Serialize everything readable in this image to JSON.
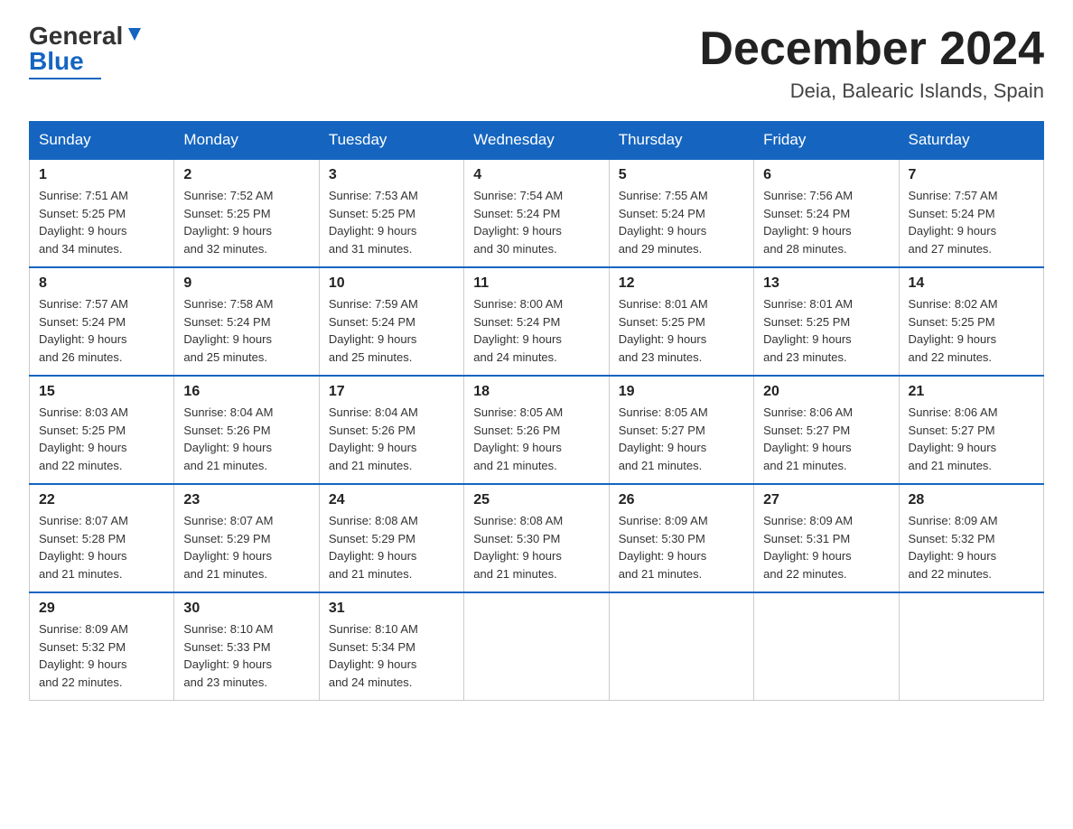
{
  "header": {
    "logo_general": "General",
    "logo_blue": "Blue",
    "title": "December 2024",
    "subtitle": "Deia, Balearic Islands, Spain"
  },
  "days_of_week": [
    "Sunday",
    "Monday",
    "Tuesday",
    "Wednesday",
    "Thursday",
    "Friday",
    "Saturday"
  ],
  "weeks": [
    [
      {
        "day": "1",
        "sunrise": "7:51 AM",
        "sunset": "5:25 PM",
        "daylight": "9 hours and 34 minutes."
      },
      {
        "day": "2",
        "sunrise": "7:52 AM",
        "sunset": "5:25 PM",
        "daylight": "9 hours and 32 minutes."
      },
      {
        "day": "3",
        "sunrise": "7:53 AM",
        "sunset": "5:25 PM",
        "daylight": "9 hours and 31 minutes."
      },
      {
        "day": "4",
        "sunrise": "7:54 AM",
        "sunset": "5:24 PM",
        "daylight": "9 hours and 30 minutes."
      },
      {
        "day": "5",
        "sunrise": "7:55 AM",
        "sunset": "5:24 PM",
        "daylight": "9 hours and 29 minutes."
      },
      {
        "day": "6",
        "sunrise": "7:56 AM",
        "sunset": "5:24 PM",
        "daylight": "9 hours and 28 minutes."
      },
      {
        "day": "7",
        "sunrise": "7:57 AM",
        "sunset": "5:24 PM",
        "daylight": "9 hours and 27 minutes."
      }
    ],
    [
      {
        "day": "8",
        "sunrise": "7:57 AM",
        "sunset": "5:24 PM",
        "daylight": "9 hours and 26 minutes."
      },
      {
        "day": "9",
        "sunrise": "7:58 AM",
        "sunset": "5:24 PM",
        "daylight": "9 hours and 25 minutes."
      },
      {
        "day": "10",
        "sunrise": "7:59 AM",
        "sunset": "5:24 PM",
        "daylight": "9 hours and 25 minutes."
      },
      {
        "day": "11",
        "sunrise": "8:00 AM",
        "sunset": "5:24 PM",
        "daylight": "9 hours and 24 minutes."
      },
      {
        "day": "12",
        "sunrise": "8:01 AM",
        "sunset": "5:25 PM",
        "daylight": "9 hours and 23 minutes."
      },
      {
        "day": "13",
        "sunrise": "8:01 AM",
        "sunset": "5:25 PM",
        "daylight": "9 hours and 23 minutes."
      },
      {
        "day": "14",
        "sunrise": "8:02 AM",
        "sunset": "5:25 PM",
        "daylight": "9 hours and 22 minutes."
      }
    ],
    [
      {
        "day": "15",
        "sunrise": "8:03 AM",
        "sunset": "5:25 PM",
        "daylight": "9 hours and 22 minutes."
      },
      {
        "day": "16",
        "sunrise": "8:04 AM",
        "sunset": "5:26 PM",
        "daylight": "9 hours and 21 minutes."
      },
      {
        "day": "17",
        "sunrise": "8:04 AM",
        "sunset": "5:26 PM",
        "daylight": "9 hours and 21 minutes."
      },
      {
        "day": "18",
        "sunrise": "8:05 AM",
        "sunset": "5:26 PM",
        "daylight": "9 hours and 21 minutes."
      },
      {
        "day": "19",
        "sunrise": "8:05 AM",
        "sunset": "5:27 PM",
        "daylight": "9 hours and 21 minutes."
      },
      {
        "day": "20",
        "sunrise": "8:06 AM",
        "sunset": "5:27 PM",
        "daylight": "9 hours and 21 minutes."
      },
      {
        "day": "21",
        "sunrise": "8:06 AM",
        "sunset": "5:27 PM",
        "daylight": "9 hours and 21 minutes."
      }
    ],
    [
      {
        "day": "22",
        "sunrise": "8:07 AM",
        "sunset": "5:28 PM",
        "daylight": "9 hours and 21 minutes."
      },
      {
        "day": "23",
        "sunrise": "8:07 AM",
        "sunset": "5:29 PM",
        "daylight": "9 hours and 21 minutes."
      },
      {
        "day": "24",
        "sunrise": "8:08 AM",
        "sunset": "5:29 PM",
        "daylight": "9 hours and 21 minutes."
      },
      {
        "day": "25",
        "sunrise": "8:08 AM",
        "sunset": "5:30 PM",
        "daylight": "9 hours and 21 minutes."
      },
      {
        "day": "26",
        "sunrise": "8:09 AM",
        "sunset": "5:30 PM",
        "daylight": "9 hours and 21 minutes."
      },
      {
        "day": "27",
        "sunrise": "8:09 AM",
        "sunset": "5:31 PM",
        "daylight": "9 hours and 22 minutes."
      },
      {
        "day": "28",
        "sunrise": "8:09 AM",
        "sunset": "5:32 PM",
        "daylight": "9 hours and 22 minutes."
      }
    ],
    [
      {
        "day": "29",
        "sunrise": "8:09 AM",
        "sunset": "5:32 PM",
        "daylight": "9 hours and 22 minutes."
      },
      {
        "day": "30",
        "sunrise": "8:10 AM",
        "sunset": "5:33 PM",
        "daylight": "9 hours and 23 minutes."
      },
      {
        "day": "31",
        "sunrise": "8:10 AM",
        "sunset": "5:34 PM",
        "daylight": "9 hours and 24 minutes."
      },
      {
        "day": "",
        "sunrise": "",
        "sunset": "",
        "daylight": ""
      },
      {
        "day": "",
        "sunrise": "",
        "sunset": "",
        "daylight": ""
      },
      {
        "day": "",
        "sunrise": "",
        "sunset": "",
        "daylight": ""
      },
      {
        "day": "",
        "sunrise": "",
        "sunset": "",
        "daylight": ""
      }
    ]
  ],
  "labels": {
    "sunrise": "Sunrise:",
    "sunset": "Sunset:",
    "daylight": "Daylight:"
  }
}
